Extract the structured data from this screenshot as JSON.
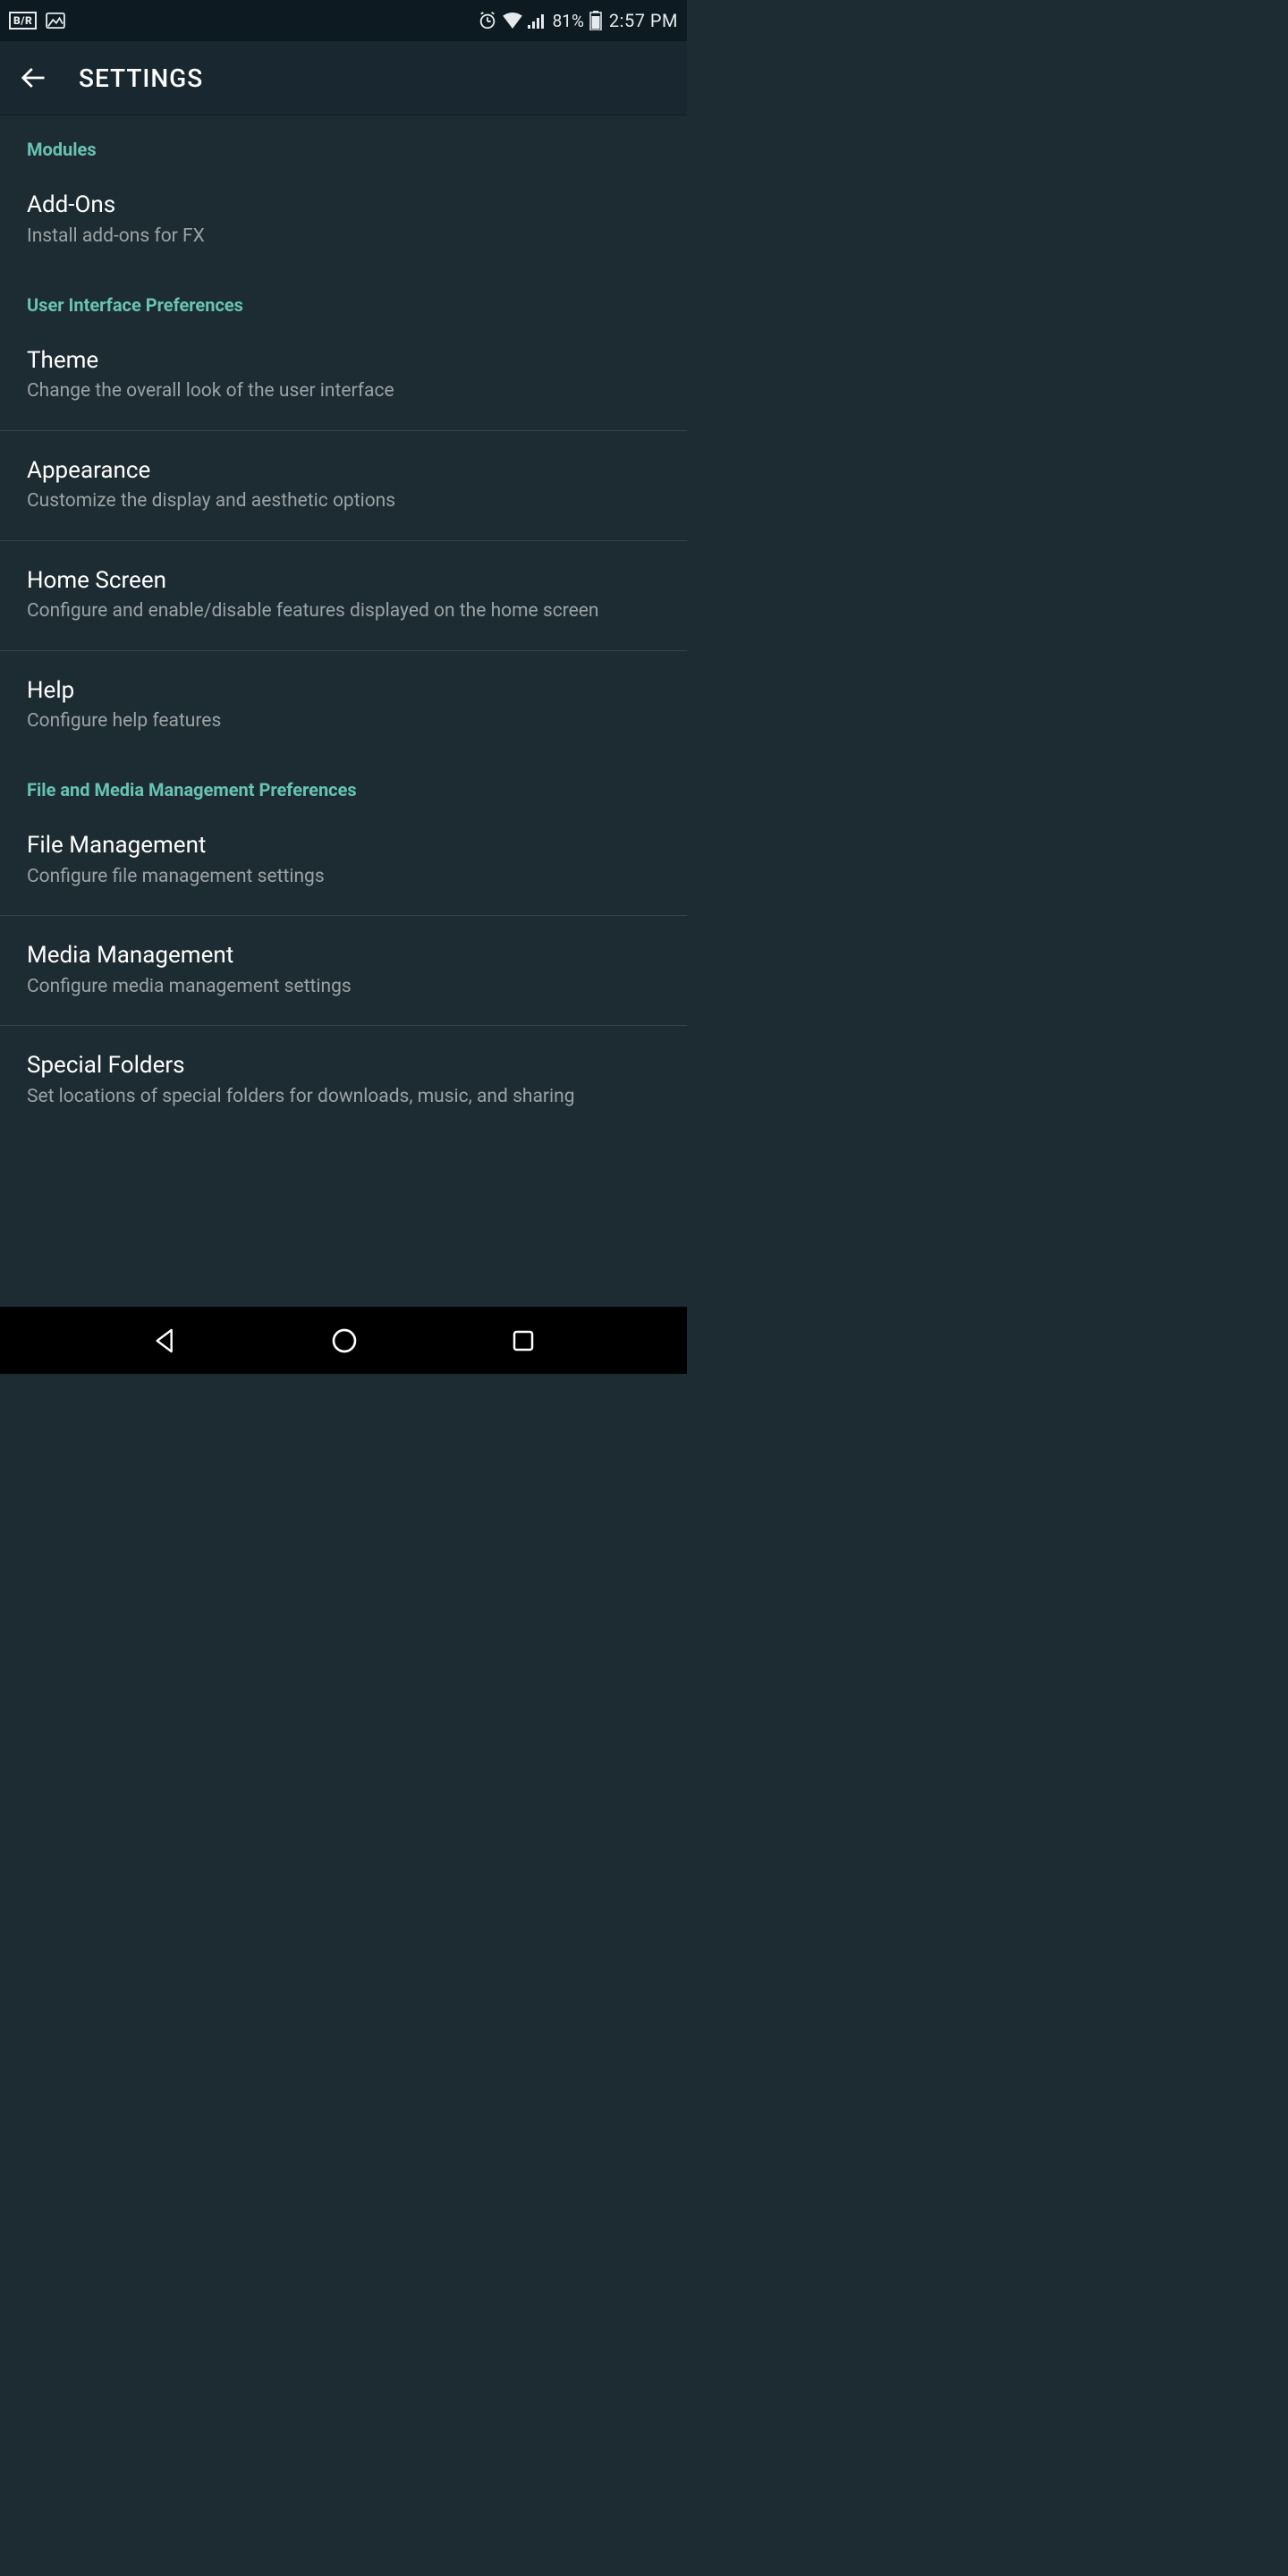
{
  "status": {
    "br_badge": "B/R",
    "battery_pct": "81%",
    "clock": "2:57 PM"
  },
  "appbar": {
    "title": "SETTINGS"
  },
  "sections": [
    {
      "header": "Modules",
      "items": [
        {
          "title": "Add-Ons",
          "sub": "Install add-ons for FX"
        }
      ]
    },
    {
      "header": "User Interface Preferences",
      "items": [
        {
          "title": "Theme",
          "sub": "Change the overall look of the user interface"
        },
        {
          "title": "Appearance",
          "sub": "Customize the display and aesthetic options"
        },
        {
          "title": "Home Screen",
          "sub": "Configure and enable/disable features displayed on the home screen"
        },
        {
          "title": "Help",
          "sub": "Configure help features"
        }
      ]
    },
    {
      "header": "File and Media Management Preferences",
      "items": [
        {
          "title": "File Management",
          "sub": "Configure file management settings"
        },
        {
          "title": "Media Management",
          "sub": "Configure media management settings"
        },
        {
          "title": "Special Folders",
          "sub": "Set locations of special folders for downloads, music, and sharing"
        }
      ]
    }
  ]
}
